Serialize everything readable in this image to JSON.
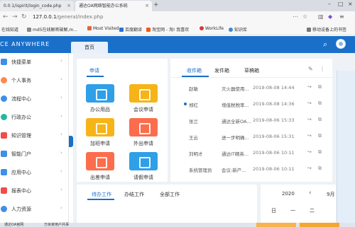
{
  "browser": {
    "tabs": [
      {
        "label": "0.0.1/ispirit/login_code.php"
      },
      {
        "label": "通达OA网络智能办公系统"
      }
    ],
    "new_tab": "+",
    "url": {
      "host": "127.0.0.1",
      "path": "/general/index.php"
    },
    "bookmarks": [
      {
        "label": "在线知道"
      },
      {
        "label": "md5在线解密破解,m..."
      },
      {
        "label": "Most Visited"
      },
      {
        "label": "百度翻译"
      },
      {
        "label": "淘宝网 - 淘! 我喜欢"
      },
      {
        "label": "WorkLife"
      },
      {
        "label": "知识库"
      },
      {
        "label": "移动设备上的书签"
      }
    ]
  },
  "header": {
    "brand": "CE ANYWHERE",
    "home_tab": "首页"
  },
  "sidebar": {
    "items": [
      {
        "label": "快捷菜单",
        "color": "#3e8fe6"
      },
      {
        "label": "个人事务",
        "color": "#ff8a4c"
      },
      {
        "label": "流程中心",
        "color": "#3e8fe6"
      },
      {
        "label": "行政办公",
        "color": "#23b9a0"
      },
      {
        "label": "知识管理",
        "color": "#f04c4c"
      },
      {
        "label": "智能门户",
        "color": "#3e8fe6"
      },
      {
        "label": "应用中心",
        "color": "#3e8fe6"
      },
      {
        "label": "报表中心",
        "color": "#f04c4c"
      },
      {
        "label": "人力资源",
        "color": "#3e8fe6"
      }
    ]
  },
  "apply_panel": {
    "tab": "申请",
    "tiles": [
      {
        "label": "办公用品",
        "color": "#2f9fe8"
      },
      {
        "label": "会议申请",
        "color": "#f6b418"
      },
      {
        "label": "加班申请",
        "color": "#f6b418"
      },
      {
        "label": "外出申请",
        "color": "#fb6d4c"
      },
      {
        "label": "出差申请",
        "color": "#fb6d4c"
      },
      {
        "label": "请假申请",
        "color": "#2f9fe8"
      }
    ]
  },
  "mail_panel": {
    "tabs": [
      "收件箱",
      "发件箱",
      "草稿箱"
    ],
    "rows": [
      {
        "sender": "赵敏",
        "subject": "灭火器使用...",
        "time": "2019-08-08 14:44",
        "unread": false
      },
      {
        "sender": "郑红",
        "subject": "增值税税率...",
        "time": "2019-08-08 14:36",
        "unread": true
      },
      {
        "sender": "张兰",
        "subject": "通达全新OA...",
        "time": "2019-08-06 15:33",
        "unread": false
      },
      {
        "sender": "王云",
        "subject": "进一步明确...",
        "time": "2019-08-06 15:31",
        "unread": false
      },
      {
        "sender": "刘明才",
        "subject": "通达IT精英...",
        "time": "2019-08-06 10:11",
        "unread": false
      },
      {
        "sender": "系统管理员",
        "subject": "会议:新产...",
        "time": "2019-08-06 10:11",
        "unread": false
      }
    ]
  },
  "work_panel": {
    "tabs": [
      "待办工作",
      "办结工作",
      "全部工作"
    ]
  },
  "calendar": {
    "year": "2020",
    "month": "9月",
    "weekdays": [
      "日",
      "一",
      "二"
    ]
  },
  "taskbar": {
    "items": [
      {
        "label": "通达OA官网"
      },
      {
        "label": "万余家用户共事"
      }
    ]
  },
  "accent_color": "#1a6fc9"
}
